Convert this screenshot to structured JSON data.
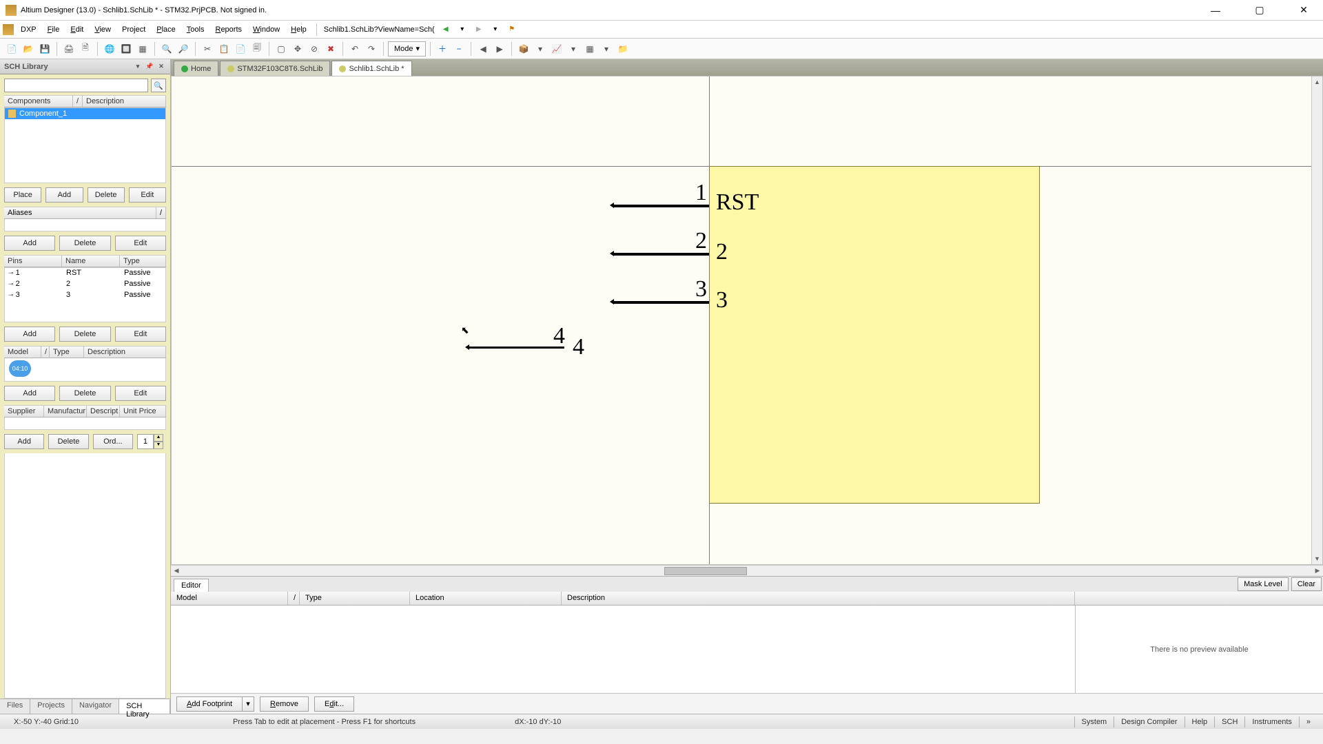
{
  "titlebar": {
    "title": "Altium Designer (13.0) - Schlib1.SchLib * - STM32.PrjPCB. Not signed in."
  },
  "menu": {
    "dxp": "DXP",
    "items": [
      "File",
      "Edit",
      "View",
      "Project",
      "Place",
      "Tools",
      "Reports",
      "Window",
      "Help"
    ],
    "crumb": "Schlib1.SchLib?ViewName=Sch("
  },
  "toolbar": {
    "mode": "Mode"
  },
  "tabs": {
    "home": "Home",
    "t1": "STM32F103C8T6.SchLib",
    "t2": "Schlib1.SchLib *"
  },
  "panel": {
    "title": "SCH Library",
    "comp_header": {
      "c0": "Components",
      "c1": "/",
      "c2": "Description"
    },
    "comp": {
      "name": "Component_1"
    },
    "btns1": {
      "place": "Place",
      "add": "Add",
      "del": "Delete",
      "edit": "Edit"
    },
    "aliases": "Aliases",
    "btns2": {
      "add": "Add",
      "del": "Delete",
      "edit": "Edit"
    },
    "pins_header": {
      "c0": "Pins",
      "c1": "Name",
      "c2": "Type"
    },
    "pins": [
      {
        "num": "1",
        "name": "RST",
        "type": "Passive"
      },
      {
        "num": "2",
        "name": "2",
        "type": "Passive"
      },
      {
        "num": "3",
        "name": "3",
        "type": "Passive"
      }
    ],
    "btns3": {
      "add": "Add",
      "del": "Delete",
      "edit": "Edit"
    },
    "model_header": {
      "c0": "Model",
      "c1": "Type",
      "c2": "Description"
    },
    "timecode": "04:10",
    "btns4": {
      "add": "Add",
      "del": "Delete",
      "edit": "Edit"
    },
    "supplier_header": {
      "c0": "Supplier",
      "c1": "Manufactur",
      "c2": "Descript",
      "c3": "Unit Price"
    },
    "btns5": {
      "add": "Add",
      "del": "Delete",
      "ord": "Ord...",
      "qty": "1"
    },
    "side_tabs": {
      "files": "Files",
      "projects": "Projects",
      "navigator": "Navigator",
      "schlib": "SCH Library"
    }
  },
  "canvas": {
    "pins": [
      {
        "num": "1",
        "label": "RST"
      },
      {
        "num": "2",
        "label": "2"
      },
      {
        "num": "3",
        "label": "3"
      }
    ],
    "floating": {
      "num": "4",
      "label": "4"
    }
  },
  "editor": {
    "tab": "Editor",
    "mask": "Mask Level",
    "clear": "Clear",
    "cols": {
      "c0": "Model",
      "c1": "Type",
      "c2": "Location",
      "c3": "Description"
    },
    "no_preview": "There is no preview available",
    "footer": {
      "addfp": "Add Footprint",
      "remove": "Remove",
      "edit": "Edit..."
    }
  },
  "status": {
    "left": "X:-50 Y:-40  Grid:10",
    "mid": "Press Tab to edit at placement - Press F1 for shortcuts",
    "dxy": "dX:-10 dY:-10",
    "rbtns": [
      "System",
      "Design Compiler",
      "Help",
      "SCH",
      "Instruments"
    ]
  }
}
